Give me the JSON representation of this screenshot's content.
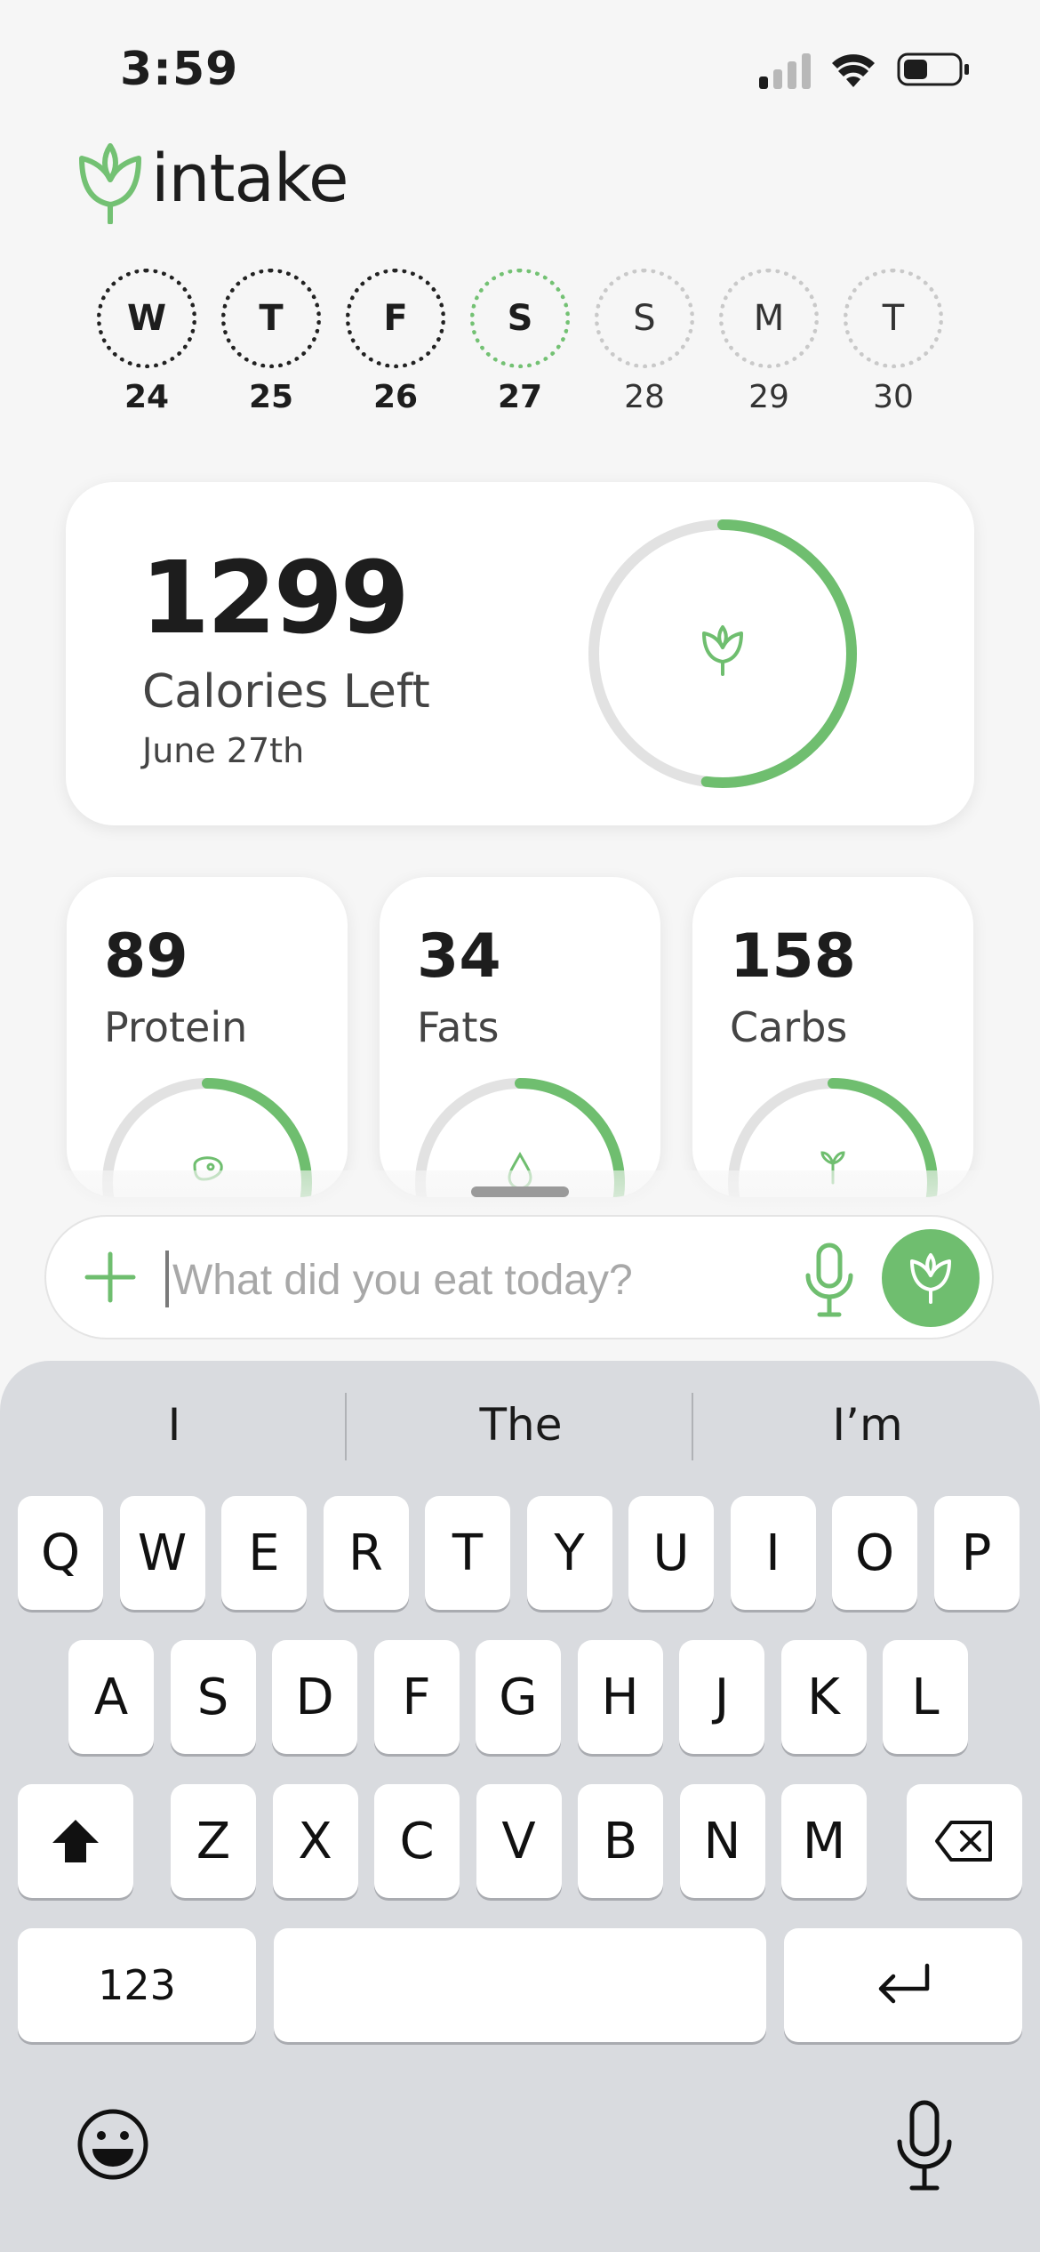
{
  "status_bar": {
    "time": "3:59"
  },
  "app": {
    "name": "intake"
  },
  "days": [
    {
      "letter": "W",
      "date": "24",
      "state": "past"
    },
    {
      "letter": "T",
      "date": "25",
      "state": "past"
    },
    {
      "letter": "F",
      "date": "26",
      "state": "past"
    },
    {
      "letter": "S",
      "date": "27",
      "state": "today"
    },
    {
      "letter": "S",
      "date": "28",
      "state": "future"
    },
    {
      "letter": "M",
      "date": "29",
      "state": "future"
    },
    {
      "letter": "T",
      "date": "30",
      "state": "future"
    }
  ],
  "calories": {
    "value": "1299",
    "label": "Calories Left",
    "date": "June 27th",
    "progress": 0.52
  },
  "macros": [
    {
      "value": "89",
      "label": "Protein",
      "progress": 0.42,
      "icon": "steak-icon"
    },
    {
      "value": "34",
      "label": "Fats",
      "progress": 0.4,
      "icon": "oil-drop-icon"
    },
    {
      "value": "158",
      "label": "Carbs",
      "progress": 0.4,
      "icon": "wheat-icon"
    }
  ],
  "chat": {
    "placeholder": "What did you eat today?"
  },
  "keyboard": {
    "suggestions": [
      "I",
      "The",
      "I’m"
    ],
    "row1": [
      "Q",
      "W",
      "E",
      "R",
      "T",
      "Y",
      "U",
      "I",
      "O",
      "P"
    ],
    "row2": [
      "A",
      "S",
      "D",
      "F",
      "G",
      "H",
      "J",
      "K",
      "L"
    ],
    "row3": [
      "Z",
      "X",
      "C",
      "V",
      "B",
      "N",
      "M"
    ],
    "numbers_label": "123"
  },
  "colors": {
    "accent": "#6fbe6f",
    "track": "#e2e2e2",
    "background": "#f6f6f6"
  }
}
